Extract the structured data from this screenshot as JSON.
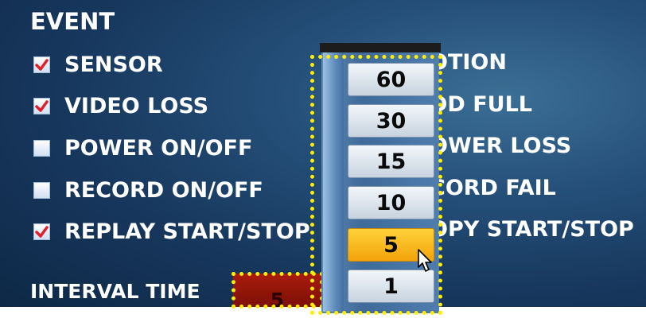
{
  "section_title": "EVENT",
  "left_events": [
    {
      "label": "SENSOR",
      "checked": true
    },
    {
      "label": "VIDEO LOSS",
      "checked": true
    },
    {
      "label": "POWER ON/OFF",
      "checked": false
    },
    {
      "label": "RECORD ON/OFF",
      "checked": false
    },
    {
      "label": "REPLAY START/STOP",
      "checked": true
    }
  ],
  "right_events_partial": [
    "OTION",
    "DD FULL",
    "OWER LOSS",
    "CORD FAIL",
    "OPY START/STOP"
  ],
  "interval": {
    "label": "INTERVAL TIME",
    "value": "5"
  },
  "dropdown": {
    "options": [
      "60",
      "30",
      "15",
      "10",
      "5",
      "1"
    ],
    "selected": "5"
  },
  "colors": {
    "checkmark": "#e01f2b",
    "highlight_dots": "#ffee00",
    "selected_option": "#f7b41a",
    "interval_field": "#a31a0a"
  }
}
